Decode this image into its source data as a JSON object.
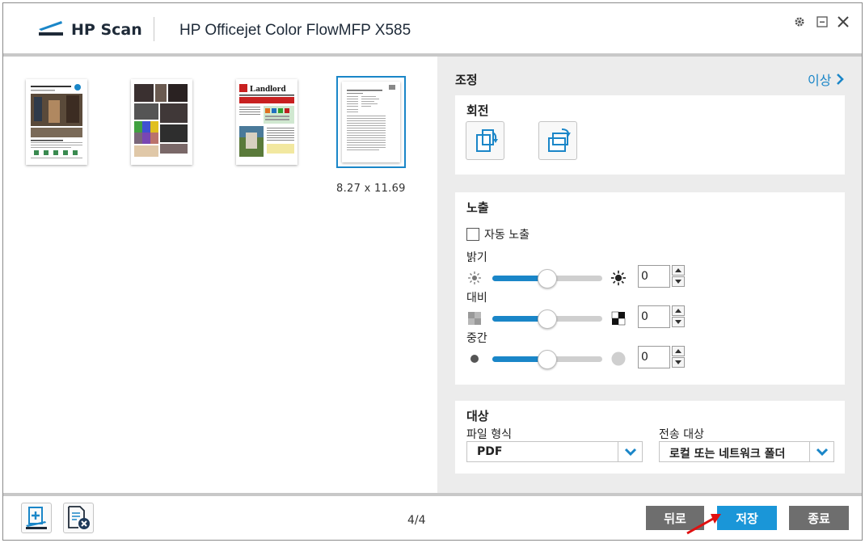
{
  "header": {
    "app_name": "HP Scan",
    "device_name": "HP Officejet Color FlowMFP X585",
    "controls": [
      "gear-icon",
      "minimize-icon",
      "close-icon"
    ]
  },
  "thumbnails": {
    "items": [
      {
        "label": "",
        "selected": false,
        "page_title": ""
      },
      {
        "label": "",
        "selected": false,
        "page_title": ""
      },
      {
        "label": "",
        "selected": false,
        "page_title": "Landlord"
      },
      {
        "label": "",
        "selected": true,
        "page_title": ""
      }
    ],
    "page_size": "8.27  x  11.69"
  },
  "adjust": {
    "title": "조정",
    "more": "이상",
    "rotation": {
      "title": "회전"
    },
    "exposure": {
      "title": "노출",
      "auto_label": "자동 노출",
      "auto_checked": false,
      "brightness": {
        "label": "밝기",
        "value": "0",
        "level": 0.5
      },
      "contrast": {
        "label": "대비",
        "value": "0",
        "level": 0.5
      },
      "midtone": {
        "label": "중간",
        "value": "0",
        "level": 0.5
      }
    },
    "destination": {
      "title": "대상",
      "file_type_label": "파일 형식",
      "file_type_value": "PDF",
      "send_to_label": "전송 대상",
      "send_to_value": "로컬 또는 네트워크 폴더"
    }
  },
  "footer": {
    "page_counter": "4/4",
    "back": "뒤로",
    "save": "저장",
    "exit": "종료"
  },
  "colors": {
    "accent": "#1a86c8",
    "button_blue": "#1a96d8",
    "button_gray": "#6e6e6e",
    "panel_bg": "#ececec",
    "annotation_red": "#e01010"
  }
}
